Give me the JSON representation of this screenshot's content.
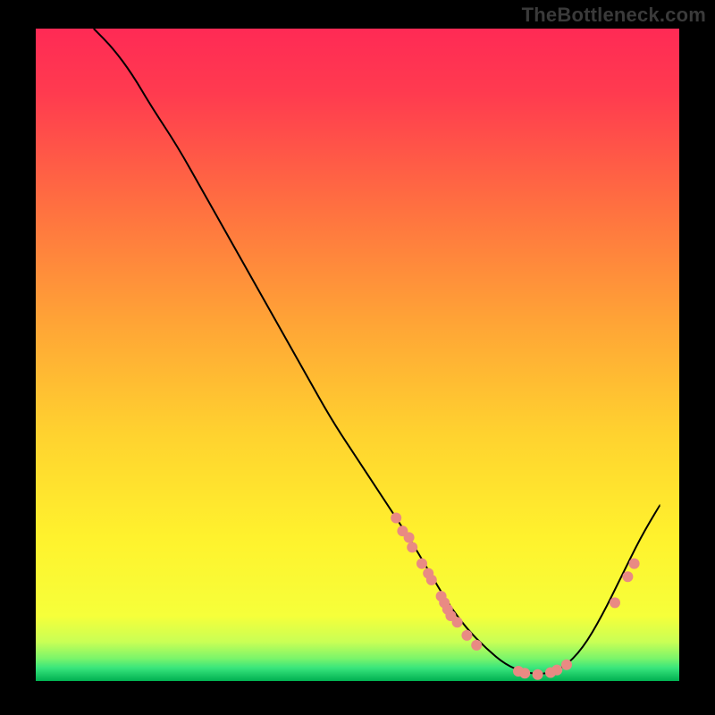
{
  "watermark": "TheBottleneck.com",
  "chart_data": {
    "type": "line",
    "title": "",
    "xlabel": "",
    "ylabel": "",
    "xlim": [
      0,
      100
    ],
    "ylim": [
      0,
      100
    ],
    "grid": false,
    "legend": false,
    "background_gradient": {
      "top": "#ff2850",
      "mid": "#ffd733",
      "bottom_band": "#2cf07f",
      "very_bottom": "#00b050"
    },
    "series": [
      {
        "name": "bottleneck-curve",
        "color": "#000000",
        "x": [
          9,
          12,
          15,
          18,
          22,
          26,
          30,
          34,
          38,
          42,
          46,
          50,
          54,
          58,
          61,
          64,
          67,
          70,
          73,
          76,
          79,
          82,
          85,
          88,
          91,
          94,
          97
        ],
        "y": [
          100,
          97,
          93,
          88,
          82,
          75,
          68,
          61,
          54,
          47,
          40,
          34,
          28,
          22,
          17,
          12,
          8,
          5,
          2.5,
          1.3,
          1,
          2,
          5,
          10,
          16,
          22,
          27
        ]
      }
    ],
    "scatter_points": {
      "name": "sample-points",
      "color": "#e98a83",
      "radius": 6,
      "points": [
        {
          "x": 56,
          "y": 25
        },
        {
          "x": 57,
          "y": 23
        },
        {
          "x": 58,
          "y": 22
        },
        {
          "x": 58.5,
          "y": 20.5
        },
        {
          "x": 60,
          "y": 18
        },
        {
          "x": 61,
          "y": 16.5
        },
        {
          "x": 61.5,
          "y": 15.5
        },
        {
          "x": 63,
          "y": 13
        },
        {
          "x": 63.5,
          "y": 12
        },
        {
          "x": 64,
          "y": 11
        },
        {
          "x": 64.5,
          "y": 10
        },
        {
          "x": 65.5,
          "y": 9
        },
        {
          "x": 67,
          "y": 7
        },
        {
          "x": 68.5,
          "y": 5.5
        },
        {
          "x": 75,
          "y": 1.5
        },
        {
          "x": 76,
          "y": 1.2
        },
        {
          "x": 78,
          "y": 1
        },
        {
          "x": 80,
          "y": 1.3
        },
        {
          "x": 81,
          "y": 1.7
        },
        {
          "x": 82.5,
          "y": 2.5
        },
        {
          "x": 90,
          "y": 12
        },
        {
          "x": 92,
          "y": 16
        },
        {
          "x": 93,
          "y": 18
        }
      ]
    }
  }
}
